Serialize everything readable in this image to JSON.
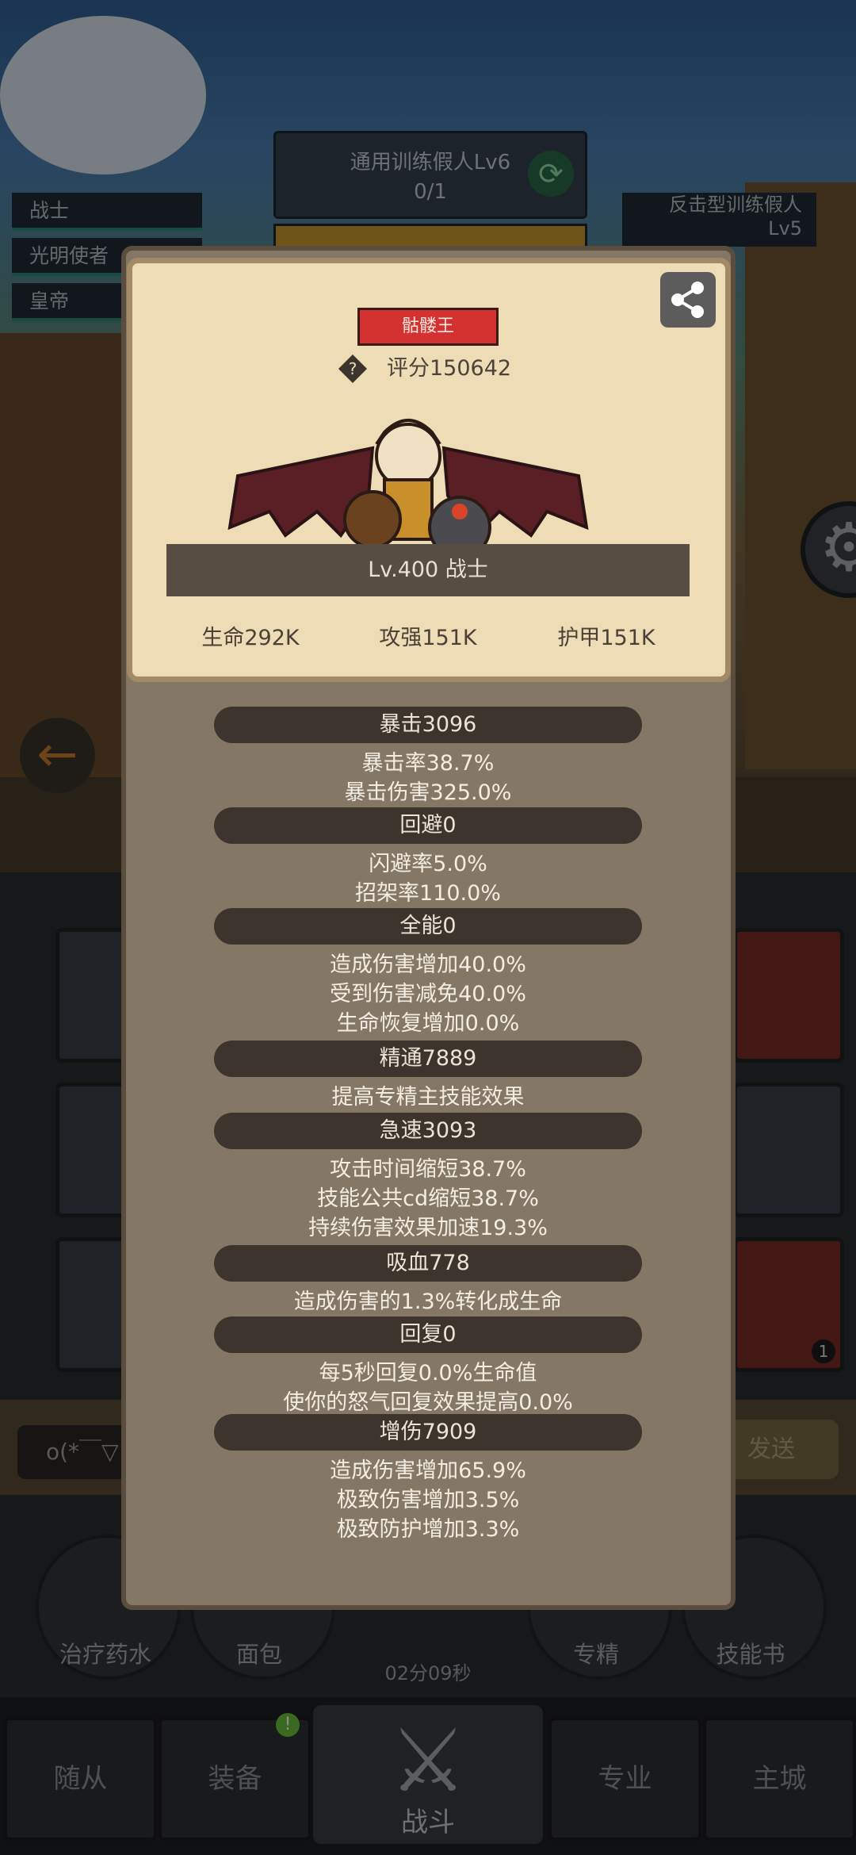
{
  "background": {
    "quest": {
      "title": "通用训练假人Lv6",
      "progress": "0/1"
    },
    "party": [
      "战士",
      "光明使者",
      "皇帝"
    ],
    "enemy_tag": {
      "name": "反击型训练假人",
      "level": "Lv5"
    },
    "chat_placeholder": "o(*￣▽",
    "send_label": "发送",
    "items": [
      {
        "label": "治疗药水"
      },
      {
        "label": "面包"
      },
      {
        "label": "专精"
      },
      {
        "label": "技能书"
      }
    ],
    "timer": "02分09秒",
    "nav": {
      "followers": "随从",
      "equipment": "装备",
      "battle": "战斗",
      "profession": "专业",
      "main_city": "主城"
    },
    "skill_count": "1"
  },
  "profile": {
    "title_badge": "骷髅王",
    "score": "评分150642",
    "level_class": "Lv.400 战士",
    "hp": "生命292K",
    "attack": "攻强151K",
    "armor": "护甲151K"
  },
  "sections": [
    {
      "head": "暴击3096",
      "lines": [
        "暴击率38.7%",
        "暴击伤害325.0%"
      ]
    },
    {
      "head": "回避0",
      "lines": [
        "闪避率5.0%",
        "招架率110.0%"
      ]
    },
    {
      "head": "全能0",
      "lines": [
        "造成伤害增加40.0%",
        "受到伤害减免40.0%",
        "生命恢复增加0.0%"
      ]
    },
    {
      "head": "精通7889",
      "lines": [
        "提高专精主技能效果"
      ]
    },
    {
      "head": "急速3093",
      "lines": [
        "攻击时间缩短38.7%",
        "技能公共cd缩短38.7%",
        "持续伤害效果加速19.3%"
      ]
    },
    {
      "head": "吸血778",
      "lines": [
        "造成伤害的1.3%转化成生命"
      ]
    },
    {
      "head": "回复0",
      "lines": [
        "每5秒回复0.0%生命值",
        "使你的怒气回复效果提高0.0%"
      ]
    },
    {
      "head": "增伤7909",
      "lines": [
        "造成伤害增加65.9%",
        "极致伤害增加3.5%",
        "极致防护增加3.3%"
      ]
    }
  ]
}
